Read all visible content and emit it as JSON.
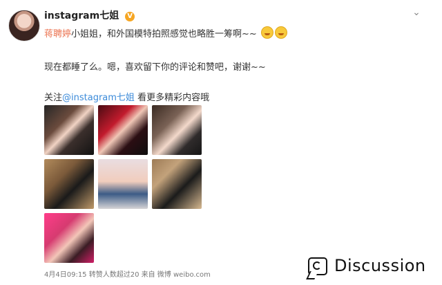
{
  "post": {
    "username": "instagram七姐",
    "verified_badge": "V",
    "mention_name": "蒋聘婷",
    "line1_rest": "小姐姐，和外国模特拍照感觉也略胜一筹啊~~",
    "line2": "现在都睡了么。嗯，喜欢留下你的评论和赞吧，谢谢~~",
    "line3_prefix": "关注",
    "line3_link": "@instagram七姐",
    "line3_suffix": " 看更多精彩内容哦",
    "footer": "4月4日09:15 转赞人数超过20 来自 微博 weibo.com"
  },
  "icons": {
    "menu": "chevron-down-icon",
    "watermark": "discussion-logo-icon"
  },
  "watermark": {
    "text": "Discussion"
  },
  "colors": {
    "mention": "#eb7350",
    "link": "#3b8ad9",
    "badge": "#f6a623"
  }
}
